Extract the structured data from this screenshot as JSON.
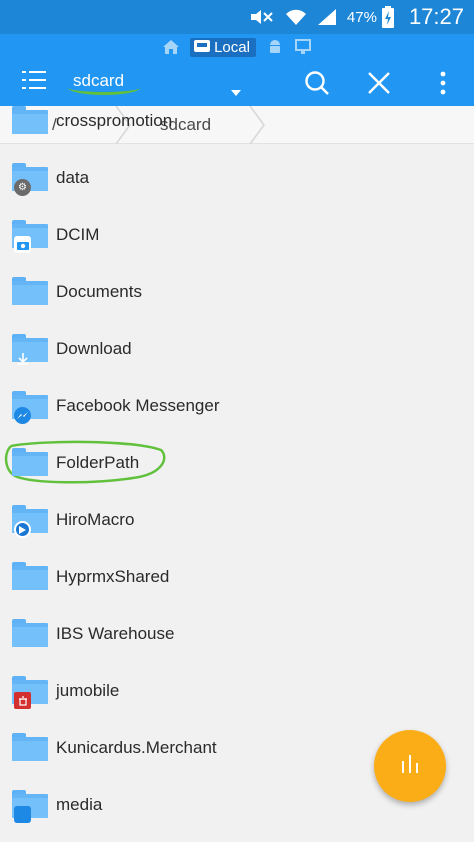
{
  "status_bar": {
    "battery_percent": "47%",
    "time": "17:27",
    "icons": [
      "mute-icon",
      "wifi-icon",
      "signal-icon",
      "battery-charging-icon"
    ]
  },
  "toolbar": {
    "location_label": "Local",
    "location_icons": [
      "home-icon",
      "local-storage-icon",
      "android-icon",
      "network-icon"
    ],
    "path_title": "sdcard",
    "actions": [
      "search-icon",
      "close-icon",
      "more-vert-icon"
    ],
    "accent": "#2196f3",
    "underline_color": "#61c13c"
  },
  "breadcrumb": {
    "items": [
      "/",
      "sdcard"
    ]
  },
  "files": [
    {
      "name": "crosspromotion",
      "badge": null
    },
    {
      "name": "data",
      "badge": "settings"
    },
    {
      "name": "DCIM",
      "badge": "camera"
    },
    {
      "name": "Documents",
      "badge": null
    },
    {
      "name": "Download",
      "badge": "download"
    },
    {
      "name": "Facebook Messenger",
      "badge": "messenger"
    },
    {
      "name": "FolderPath",
      "badge": null
    },
    {
      "name": "HiroMacro",
      "badge": "play"
    },
    {
      "name": "HyprmxShared",
      "badge": null
    },
    {
      "name": "IBS Warehouse",
      "badge": null
    },
    {
      "name": "jumobile",
      "badge": "app"
    },
    {
      "name": "Kunicardus.Merchant",
      "badge": null
    },
    {
      "name": "media",
      "badge": "media"
    }
  ],
  "fab": {
    "icon": "analyze-bars-icon",
    "color": "#fbad17"
  }
}
